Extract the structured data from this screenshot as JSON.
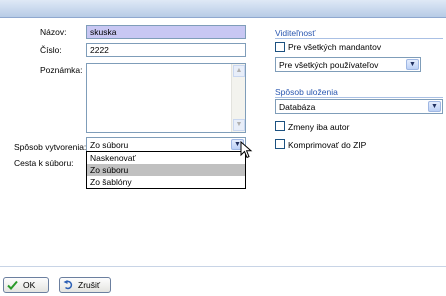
{
  "form": {
    "name_label": "Názov:",
    "name_value": "skuska",
    "number_label": "Číslo:",
    "number_value": "2222",
    "note_label": "Poznámka:",
    "creation_label": "Spôsob vytvorenia:",
    "creation_value": "Zo súboru",
    "creation_options": [
      "Naskenovať",
      "Zo súboru",
      "Zo šablóny"
    ],
    "creation_selected_index": 1,
    "path_label": "Cesta k súboru:"
  },
  "visibility": {
    "title": "Viditeľnosť",
    "all_mandants_label": "Pre všetkých mandantov",
    "all_mandants_checked": false,
    "users_value": "Pre všetkých používateľov"
  },
  "storage": {
    "title": "Spôsob uloženia",
    "method_value": "Databáza",
    "author_only_label": "Zmeny iba autor",
    "author_only_checked": false,
    "zip_label": "Komprimovať do ZIP",
    "zip_checked": false
  },
  "buttons": {
    "ok_label": "OK",
    "cancel_label": "Zrušiť"
  },
  "colors": {
    "highlight_field": "#c8c7f3",
    "section_title": "#2a57b0",
    "ok_check": "#2a9a2a",
    "cancel_arrow": "#2b5fb5"
  },
  "icons": {
    "ok": "check-icon",
    "cancel": "undo-arrow-icon",
    "dropdown": "chevron-down-icon"
  }
}
